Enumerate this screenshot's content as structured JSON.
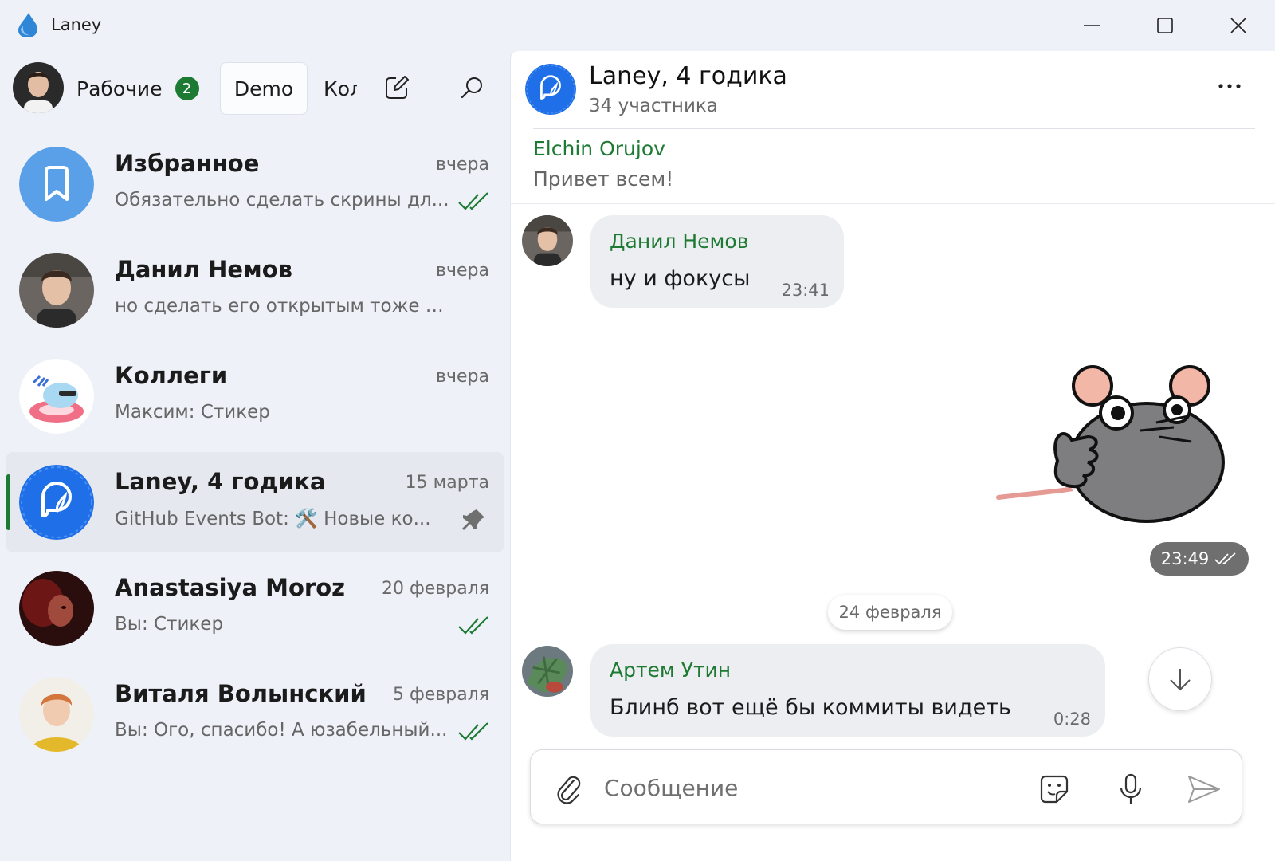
{
  "app": {
    "title": "Laney"
  },
  "colors": {
    "accent": "#1c7a32",
    "selected_row": "#e5e8ef",
    "bubble": "#eceef2"
  },
  "sidebar": {
    "folders": [
      {
        "label": "Рабочие",
        "badge": "2"
      },
      {
        "label": "Demo"
      },
      {
        "label": "Кол"
      }
    ],
    "chats": [
      {
        "name": "Избранное",
        "time": "вчера",
        "preview": "Обязательно сделать скрины дл...",
        "status": "read-checks-icon"
      },
      {
        "name": "Данил Немов",
        "time": "вчера",
        "preview": "но сделать его открытым тоже оче..."
      },
      {
        "name": "Коллеги",
        "time": "вчера",
        "preview": "Максим: Стикер"
      },
      {
        "name": "Laney, 4 годика",
        "time": "15 марта",
        "preview": "GitHub Events Bot: 🛠️ Новые ко...",
        "status": "pin-icon"
      },
      {
        "name": "Anastasiya Moroz",
        "time": "20 февраля",
        "preview": "Вы: Стикер",
        "status": "read-checks-icon"
      },
      {
        "name": "Виталя Волынский",
        "time": "5 февраля",
        "preview": "Вы: Ого, спасибо! А юзабельный...",
        "status": "read-checks-icon"
      }
    ]
  },
  "chat": {
    "title": "Laney, 4 годика",
    "subtitle": "34 участника",
    "pinned": {
      "author": "Elchin Orujov",
      "text": "Привет всем!"
    },
    "messages": [
      {
        "author": "Данил Немов",
        "text": "ну и фокусы",
        "time": "23:41"
      },
      {
        "sticker_time": "23:49"
      },
      {
        "date_separator": "24 февраля"
      },
      {
        "author": "Артем Утин",
        "text": "Блинб вот ещё бы коммиты видеть",
        "time": "0:28"
      }
    ]
  },
  "composer": {
    "placeholder": "Сообщение"
  }
}
